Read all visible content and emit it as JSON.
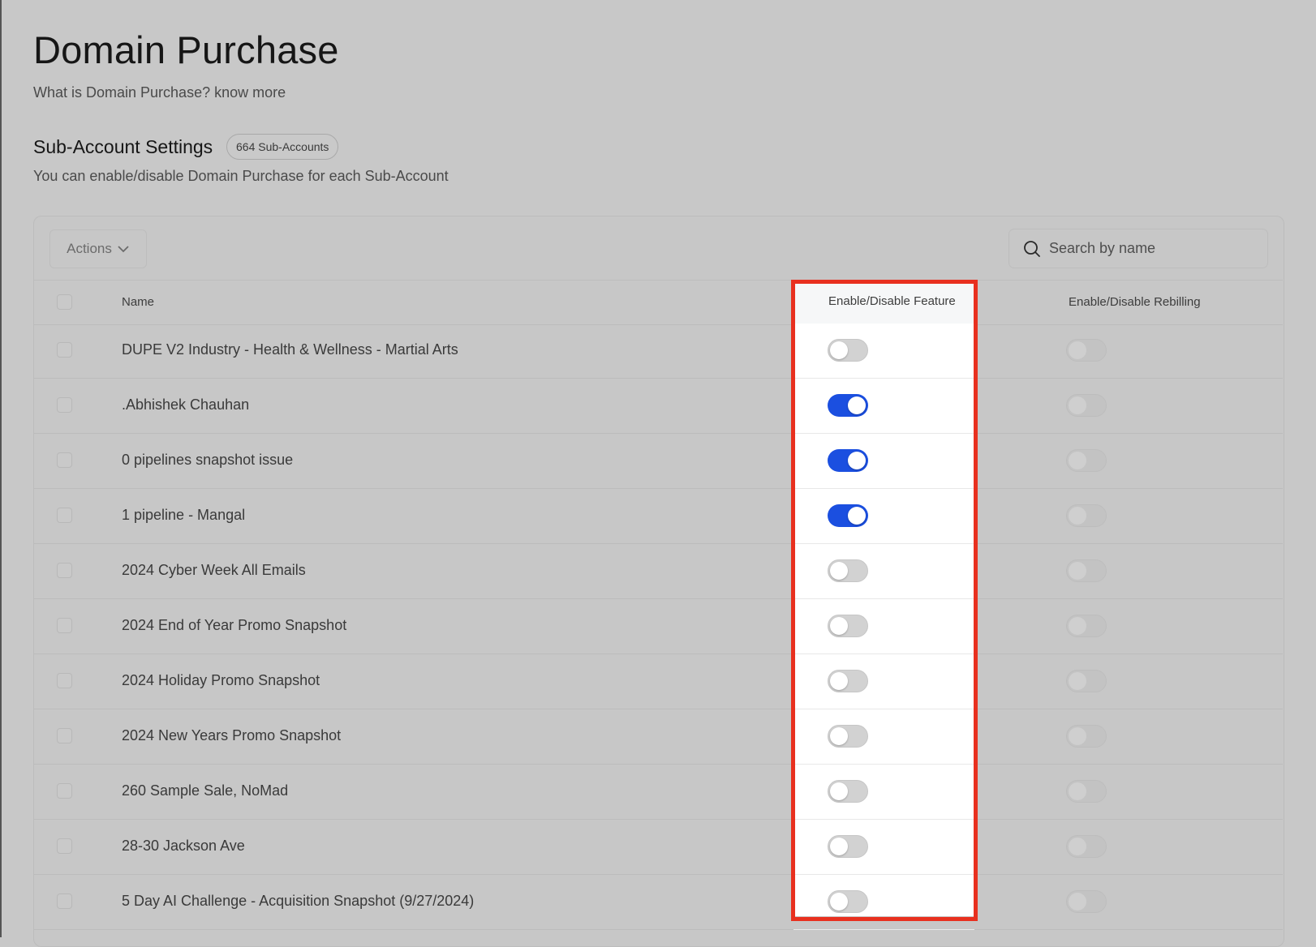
{
  "page": {
    "title": "Domain Purchase",
    "subtitle": "What is Domain Purchase? know more"
  },
  "section": {
    "title": "Sub-Account Settings",
    "badge": "664 Sub-Accounts",
    "description": "You can enable/disable Domain Purchase for each Sub-Account"
  },
  "toolbar": {
    "actions_label": "Actions",
    "search_placeholder": "Search by name"
  },
  "table": {
    "columns": {
      "name": "Name",
      "feature": "Enable/Disable Feature",
      "rebilling": "Enable/Disable Rebilling"
    },
    "rows": [
      {
        "name": "DUPE V2 Industry - Health & Wellness - Martial Arts",
        "feature_enabled": false,
        "rebilling_enabled": false
      },
      {
        "name": ".Abhishek Chauhan",
        "feature_enabled": true,
        "rebilling_enabled": false
      },
      {
        "name": "0 pipelines snapshot issue",
        "feature_enabled": true,
        "rebilling_enabled": false
      },
      {
        "name": "1 pipeline - Mangal",
        "feature_enabled": true,
        "rebilling_enabled": false
      },
      {
        "name": "2024 Cyber Week All Emails",
        "feature_enabled": false,
        "rebilling_enabled": false
      },
      {
        "name": "2024 End of Year Promo Snapshot",
        "feature_enabled": false,
        "rebilling_enabled": false
      },
      {
        "name": "2024 Holiday Promo Snapshot",
        "feature_enabled": false,
        "rebilling_enabled": false
      },
      {
        "name": "2024 New Years Promo Snapshot",
        "feature_enabled": false,
        "rebilling_enabled": false
      },
      {
        "name": "260 Sample Sale, NoMad",
        "feature_enabled": false,
        "rebilling_enabled": false
      },
      {
        "name": "28-30 Jackson Ave",
        "feature_enabled": false,
        "rebilling_enabled": false
      },
      {
        "name": "5 Day AI Challenge - Acquisition Snapshot (9/27/2024)",
        "feature_enabled": false,
        "rebilling_enabled": false
      }
    ]
  },
  "colors": {
    "toggle_on": "#1b4fe0",
    "highlight_outline": "#e8301f",
    "overlay_bg": "#c8c8c8"
  },
  "icons": {
    "search": "search-icon",
    "actions_dropdown": "chevron-down-icon"
  }
}
